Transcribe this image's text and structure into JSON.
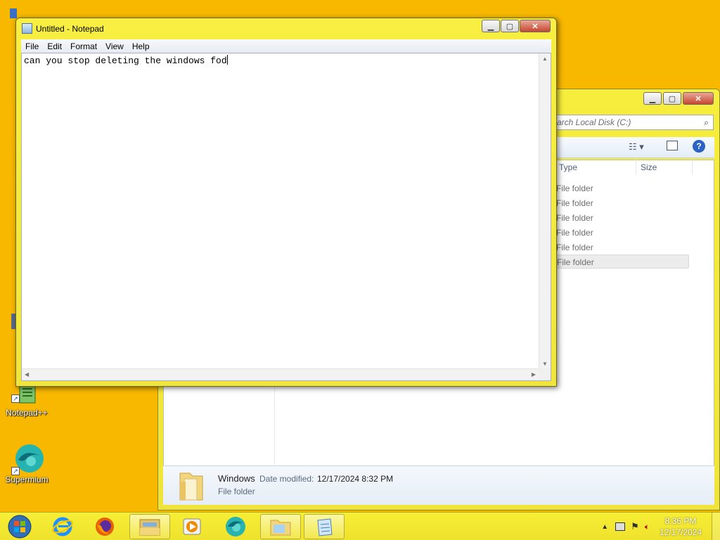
{
  "desktop": {
    "icons": [
      {
        "label": "Notepad++"
      },
      {
        "label": "Supermium"
      }
    ]
  },
  "explorer": {
    "search_placeholder": "arch Local Disk (C:)",
    "columns": {
      "type": "Type",
      "size": "Size"
    },
    "rows": [
      {
        "type": "File folder"
      },
      {
        "type": "File folder"
      },
      {
        "type": "File folder"
      },
      {
        "type": "File folder"
      },
      {
        "type": "File folder"
      },
      {
        "type": "File folder"
      }
    ],
    "details": {
      "name": "Windows",
      "modified_label": "Date modified:",
      "modified_value": "12/17/2024 8:32 PM",
      "kind": "File folder"
    }
  },
  "notepad": {
    "title": "Untitled - Notepad",
    "menu": {
      "file": "File",
      "edit": "Edit",
      "format": "Format",
      "view": "View",
      "help": "Help"
    },
    "content": "can you stop deleting the windows fod"
  },
  "taskbar": {
    "clock_time": "8:36 PM",
    "clock_date": "12/17/2024"
  },
  "colors": {
    "desktop": "#f8b800",
    "window_frame": "#f6ed3c",
    "taskbar": "#f7ee36"
  }
}
